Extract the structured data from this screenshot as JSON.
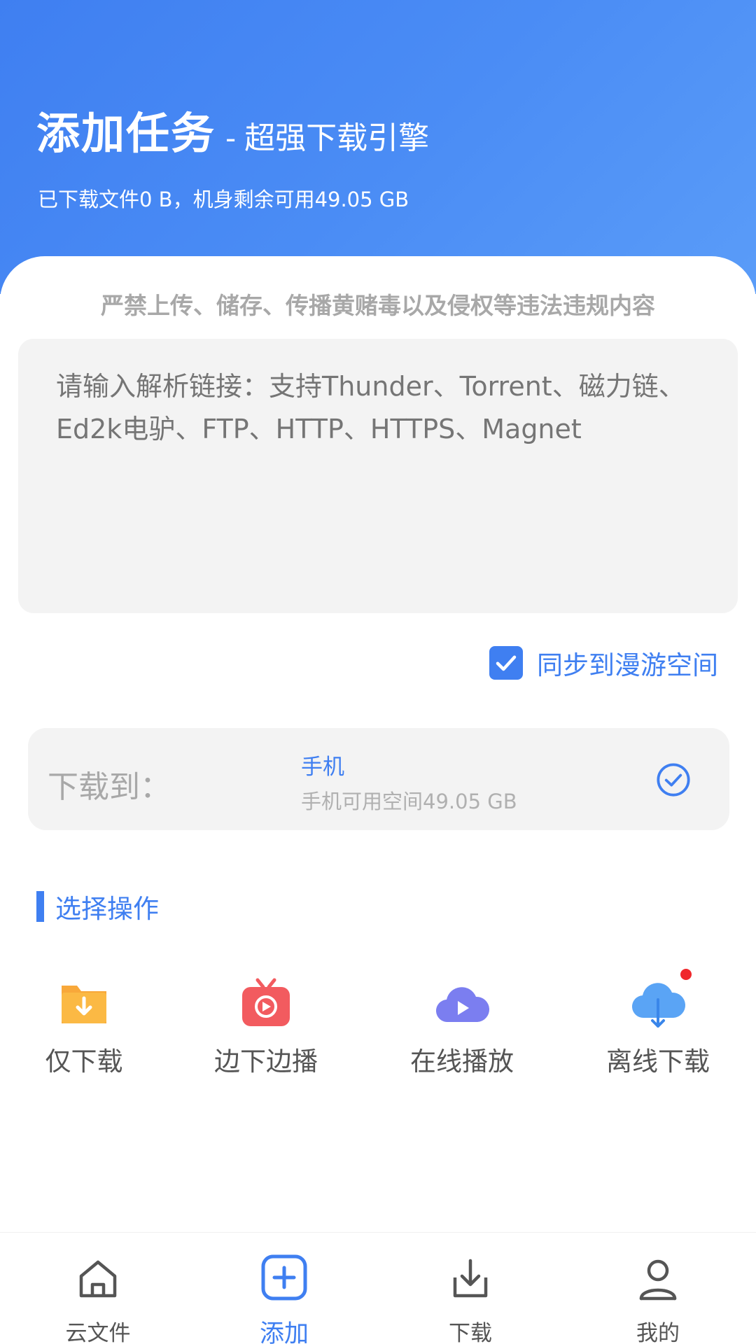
{
  "header": {
    "title_main": "添加任务",
    "title_sep": "-",
    "title_sub": "超强下载引擎",
    "storage_info": "已下载文件0 B，机身剩余可用49.05 GB"
  },
  "notice": "严禁上传、储存、传播黄赌毒以及侵权等违法违规内容",
  "link_input": {
    "value": "",
    "placeholder": "请输入解析链接：支持Thunder、Torrent、磁力链、Ed2k电驴、FTP、HTTP、HTTPS、Magnet"
  },
  "sync": {
    "label": "同步到漫游空间",
    "checked": true
  },
  "download_to": {
    "label": "下载到：",
    "device": "手机",
    "space": "手机可用空间49.05 GB"
  },
  "section": {
    "title": "选择操作"
  },
  "actions": [
    {
      "label": "仅下载",
      "icon": "download-folder-icon"
    },
    {
      "label": "边下边播",
      "icon": "tv-play-icon"
    },
    {
      "label": "在线播放",
      "icon": "cloud-play-icon"
    },
    {
      "label": "离线下载",
      "icon": "cloud-download-icon",
      "badge": true
    }
  ],
  "nav": [
    {
      "label": "云文件",
      "icon": "home-icon"
    },
    {
      "label": "添加",
      "icon": "add-icon",
      "active": true
    },
    {
      "label": "下载",
      "icon": "download-icon"
    },
    {
      "label": "我的",
      "icon": "user-icon"
    }
  ],
  "colors": {
    "accent": "#3f7ff1",
    "badge": "#f0282c",
    "folder": "#f8a83a",
    "tv": "#f25b5f",
    "cloud_play": "#7b7ef0",
    "cloud_download": "#5aa4f5"
  }
}
